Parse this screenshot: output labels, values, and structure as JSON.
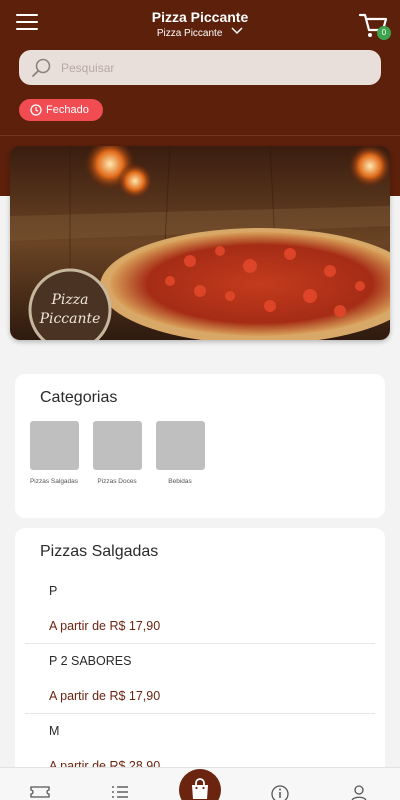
{
  "header": {
    "title": "Pizza Piccante",
    "store_selector": "Pizza Piccante",
    "cart_count": "0"
  },
  "search": {
    "placeholder": "Pesquisar"
  },
  "status": {
    "label": "Fechado"
  },
  "banner": {
    "logo_text_line1": "Pizza",
    "logo_text_line2": "Piccante"
  },
  "categories": {
    "title": "Categorias",
    "items": [
      {
        "label": "Pizzas Salgadas"
      },
      {
        "label": "Pizzas Doces"
      },
      {
        "label": "Bebidas"
      }
    ]
  },
  "section": {
    "title": "Pizzas Salgadas",
    "products": [
      {
        "name": "P",
        "price": "A partir de R$ 17,90"
      },
      {
        "name": "P 2 SABORES",
        "price": "A partir de R$ 17,90"
      },
      {
        "name": "M",
        "price": "A partir de R$ 28,90"
      }
    ]
  },
  "nav": {
    "items": [
      {
        "icon": "ticket-icon"
      },
      {
        "icon": "menu-list-icon"
      },
      {
        "icon": "shopping-bag-icon"
      },
      {
        "icon": "info-icon"
      },
      {
        "icon": "user-icon"
      }
    ]
  },
  "colors": {
    "brand": "#5c200b",
    "status_closed": "#f14c52",
    "price": "#6b2410",
    "badge": "#3fa34d"
  }
}
